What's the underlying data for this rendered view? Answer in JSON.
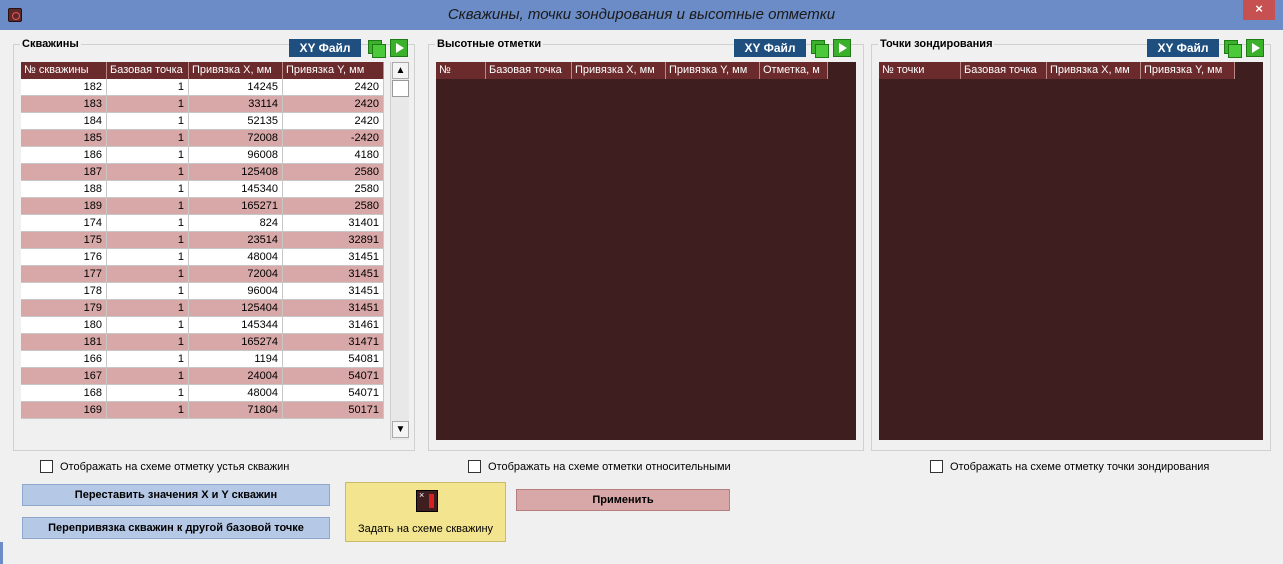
{
  "window": {
    "title": "Скважины, точки зондирования и высотные отметки",
    "close_label": "×"
  },
  "wells": {
    "title": "Скважины",
    "xy_file_label": "XY Файл",
    "columns": [
      "№ скважины",
      "Базовая точка",
      "Привязка X, мм",
      "Привязка Y, мм"
    ],
    "rows": [
      [
        "182",
        "1",
        "14245",
        "2420"
      ],
      [
        "183",
        "1",
        "33114",
        "2420"
      ],
      [
        "184",
        "1",
        "52135",
        "2420"
      ],
      [
        "185",
        "1",
        "72008",
        "-2420"
      ],
      [
        "186",
        "1",
        "96008",
        "4180"
      ],
      [
        "187",
        "1",
        "125408",
        "2580"
      ],
      [
        "188",
        "1",
        "145340",
        "2580"
      ],
      [
        "189",
        "1",
        "165271",
        "2580"
      ],
      [
        "174",
        "1",
        "824",
        "31401"
      ],
      [
        "175",
        "1",
        "23514",
        "32891"
      ],
      [
        "176",
        "1",
        "48004",
        "31451"
      ],
      [
        "177",
        "1",
        "72004",
        "31451"
      ],
      [
        "178",
        "1",
        "96004",
        "31451"
      ],
      [
        "179",
        "1",
        "125404",
        "31451"
      ],
      [
        "180",
        "1",
        "145344",
        "31461"
      ],
      [
        "181",
        "1",
        "165274",
        "31471"
      ],
      [
        "166",
        "1",
        "1194",
        "54081"
      ],
      [
        "167",
        "1",
        "24004",
        "54071"
      ],
      [
        "168",
        "1",
        "48004",
        "54071"
      ],
      [
        "169",
        "1",
        "71804",
        "50171"
      ]
    ],
    "scroll_up": "▲",
    "scroll_down": "▼"
  },
  "elevations": {
    "title": "Высотные отметки",
    "xy_file_label": "XY Файл",
    "columns": [
      "№",
      "Базовая точка",
      "Привязка X, мм",
      "Привязка Y, мм",
      "Отметка, м"
    ]
  },
  "probes": {
    "title": "Точки зондирования",
    "xy_file_label": "XY Файл",
    "columns": [
      "№ точки",
      "Базовая точка",
      "Привязка X, мм",
      "Привязка Y, мм"
    ]
  },
  "options": {
    "show_wellhead": "Отображать на схеме отметку устья скважин",
    "relative_marks": "Отображать на схеме отметки относительными",
    "show_probe_mark": "Отображать на схеме отметку точки зондирования"
  },
  "actions": {
    "swap_xy": "Переставить значения X и Y скважин",
    "rebind_wells": "Перепривязка скважин к другой базовой точке",
    "pick_on_scheme": "Задать на схеме скважину",
    "apply": "Применить"
  },
  "colors": {
    "grid_bg": "#3f1e20",
    "header_bg": "#6b2a2c",
    "row_alt": "#d8a8a8",
    "titlebar": "#6b8cc6"
  }
}
